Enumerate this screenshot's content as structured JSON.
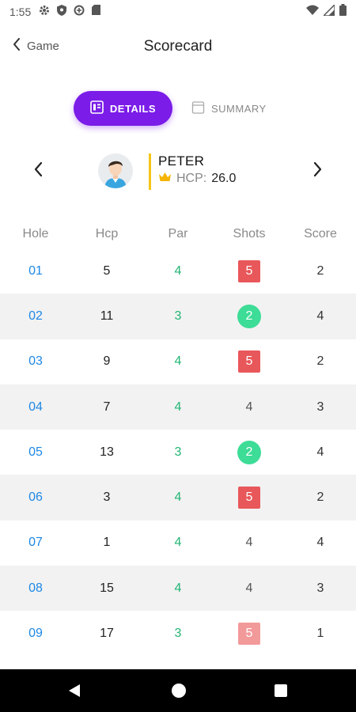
{
  "status_bar": {
    "time": "1:55"
  },
  "header": {
    "back_label": "Game",
    "title": "Scorecard"
  },
  "tabs": [
    {
      "label": "DETAILS",
      "active": true
    },
    {
      "label": "SUMMARY",
      "active": false
    }
  ],
  "player": {
    "name": "PETER",
    "hcp_label": "HCP:",
    "hcp_value": "26.0"
  },
  "table": {
    "columns": [
      "Hole",
      "Hcp",
      "Par",
      "Shots",
      "Score"
    ],
    "rows": [
      {
        "hole": "01",
        "hcp": "5",
        "par": "4",
        "shots": "5",
        "shot_style": "square",
        "shot_color": "#e8575a",
        "score": "2"
      },
      {
        "hole": "02",
        "hcp": "11",
        "par": "3",
        "shots": "2",
        "shot_style": "circle",
        "shot_color": "#3ddc97",
        "score": "4"
      },
      {
        "hole": "03",
        "hcp": "9",
        "par": "4",
        "shots": "5",
        "shot_style": "square",
        "shot_color": "#e8575a",
        "score": "2"
      },
      {
        "hole": "04",
        "hcp": "7",
        "par": "4",
        "shots": "4",
        "shot_style": "plain",
        "shot_color": "",
        "score": "3"
      },
      {
        "hole": "05",
        "hcp": "13",
        "par": "3",
        "shots": "2",
        "shot_style": "circle",
        "shot_color": "#3ddc97",
        "score": "4"
      },
      {
        "hole": "06",
        "hcp": "3",
        "par": "4",
        "shots": "5",
        "shot_style": "square",
        "shot_color": "#e8575a",
        "score": "2"
      },
      {
        "hole": "07",
        "hcp": "1",
        "par": "4",
        "shots": "4",
        "shot_style": "plain",
        "shot_color": "",
        "score": "4"
      },
      {
        "hole": "08",
        "hcp": "15",
        "par": "4",
        "shots": "4",
        "shot_style": "plain",
        "shot_color": "",
        "score": "3"
      },
      {
        "hole": "09",
        "hcp": "17",
        "par": "3",
        "shots": "5",
        "shot_style": "square",
        "shot_color": "#f29a9a",
        "score": "1"
      }
    ]
  },
  "colors": {
    "accent": "#7b1ce8",
    "hole_link": "#1e88e5",
    "par": "#22b573",
    "highlight": "#f5c518"
  }
}
